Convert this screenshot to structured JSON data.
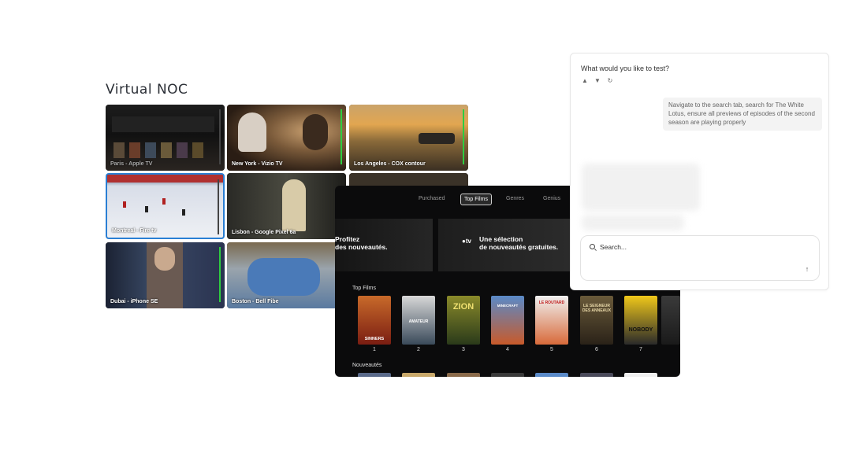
{
  "page": {
    "title": "Virtual NOC"
  },
  "tiles": [
    {
      "label": "Paris - Apple TV"
    },
    {
      "label": "New York - Vizio TV"
    },
    {
      "label": "Los Angeles - COX contour"
    },
    {
      "label": "Montreal - Fire tv"
    },
    {
      "label": "Lisbon - Google Pixel 6a"
    },
    {
      "label": "Dubai - iPhone SE"
    },
    {
      "label": "Boston - Bell Fibe"
    }
  ],
  "appletv": {
    "tabs": [
      "Purchased",
      "Top Films",
      "Genres",
      "Genius"
    ],
    "active_tab": "Top Films",
    "hero_left": "Profitez\ndes nouveautés.",
    "hero_right_logo": "tv",
    "hero_right": "Une sélection\nde nouveautés gratuites.",
    "section_top": "Top Films",
    "section_new": "Nouveautés",
    "posters": [
      {
        "rank": "1",
        "title": "SINNERS"
      },
      {
        "rank": "2",
        "title": "AMATEUR"
      },
      {
        "rank": "3",
        "title": "ZION"
      },
      {
        "rank": "4",
        "title": "MINECRAFT"
      },
      {
        "rank": "5",
        "title": "LE ROUTARD"
      },
      {
        "rank": "6",
        "title": "LE SEIGNEUR DES ANNEAUX"
      },
      {
        "rank": "7",
        "title": "NOBODY"
      }
    ]
  },
  "chat": {
    "question": "What would you like to test?",
    "message": "Navigate to the search tab, search for The White Lotus, ensure all previews of episodes of the second season are playing properly",
    "search_placeholder": "Search..."
  },
  "colors": {
    "accent": "#2a7fd4",
    "signal": "#2ecc40"
  }
}
